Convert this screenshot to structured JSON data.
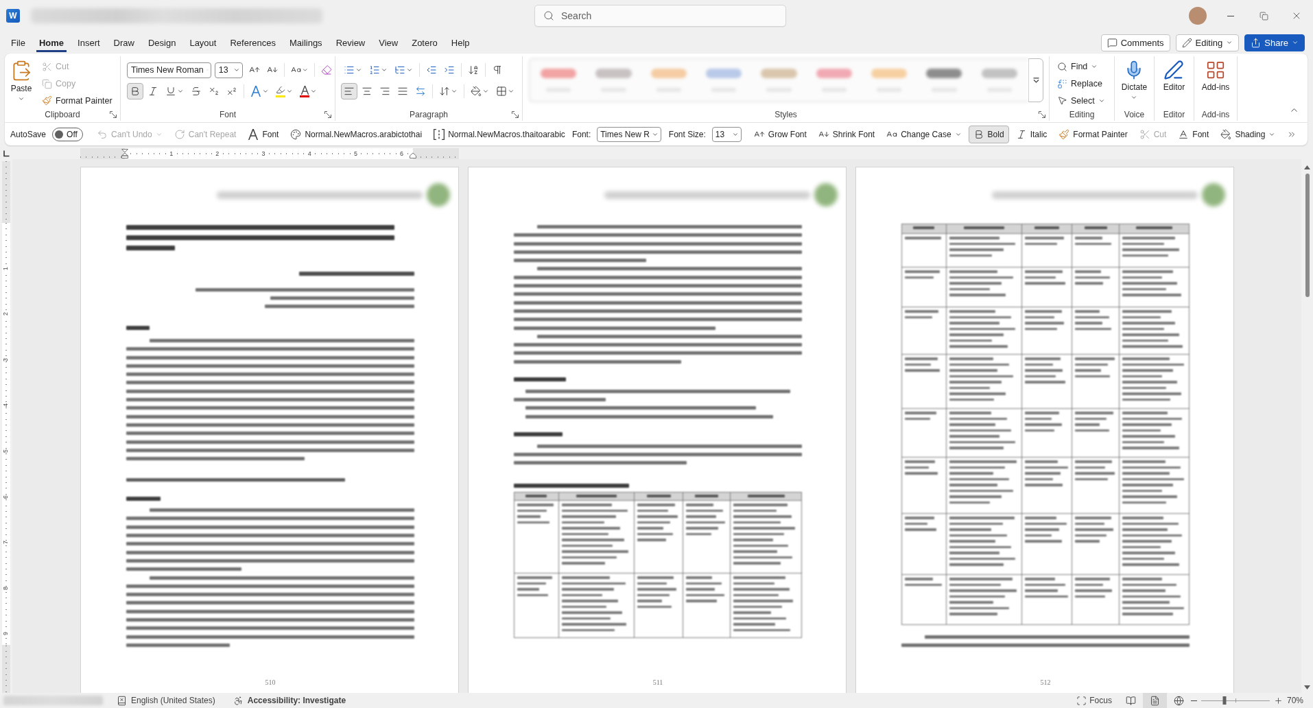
{
  "title_bar": {
    "app_letter": "W",
    "search": {
      "placeholder": "Search"
    }
  },
  "menu": {
    "tabs": [
      {
        "label": "File",
        "selected": false
      },
      {
        "label": "Home",
        "selected": true
      },
      {
        "label": "Insert",
        "selected": false
      },
      {
        "label": "Draw",
        "selected": false
      },
      {
        "label": "Design",
        "selected": false
      },
      {
        "label": "Layout",
        "selected": false
      },
      {
        "label": "References",
        "selected": false
      },
      {
        "label": "Mailings",
        "selected": false
      },
      {
        "label": "Review",
        "selected": false
      },
      {
        "label": "View",
        "selected": false
      },
      {
        "label": "Zotero",
        "selected": false
      },
      {
        "label": "Help",
        "selected": false
      }
    ],
    "buttons": [
      {
        "kind": "comments",
        "label": "Comments"
      },
      {
        "kind": "editing",
        "label": "Editing"
      },
      {
        "kind": "share",
        "label": "Share"
      }
    ]
  },
  "ribbon": {
    "clipboard": {
      "label": "Clipboard",
      "paste": "Paste",
      "items": [
        {
          "kind": "cut",
          "label": "Cut",
          "disabled": true
        },
        {
          "kind": "copy",
          "label": "Copy",
          "disabled": true
        },
        {
          "kind": "painter",
          "label": "Format Painter",
          "disabled": false
        }
      ]
    },
    "font": {
      "label": "Font",
      "font_name": "Times New Roman",
      "font_size": "13",
      "toggles": [
        {
          "kind": "bold",
          "on": true
        },
        {
          "kind": "italic",
          "on": false
        },
        {
          "kind": "underline",
          "on": false
        },
        {
          "kind": "strikethrough",
          "on": false
        },
        {
          "kind": "subscript",
          "on": false
        },
        {
          "kind": "superscript",
          "on": false
        }
      ]
    },
    "paragraph": {
      "label": "Paragraph",
      "alignments": [
        {
          "kind": "left",
          "selected": true
        },
        {
          "kind": "center",
          "selected": false
        },
        {
          "kind": "right",
          "selected": false
        },
        {
          "kind": "justify",
          "selected": false
        }
      ]
    },
    "styles": {
      "label": "Styles"
    },
    "editing": {
      "label": "Editing",
      "items": [
        {
          "kind": "find",
          "label": "Find",
          "dropdown": true
        },
        {
          "kind": "replace",
          "label": "Replace",
          "dropdown": false
        },
        {
          "kind": "select",
          "label": "Select",
          "dropdown": true
        }
      ]
    },
    "voice": {
      "label": "Voice",
      "button": "Dictate"
    },
    "editor": {
      "label": "Editor",
      "button": "Editor"
    },
    "add_ins": {
      "label": "Add-ins",
      "button": "Add-ins"
    }
  },
  "quick_access": {
    "autosave": {
      "label": "AutoSave",
      "on": false,
      "state": "Off"
    },
    "items": [
      {
        "kind": "undo",
        "label": "Can't Undo",
        "disabled": true,
        "pressed": false,
        "dropdown": true
      },
      {
        "kind": "repeat",
        "label": "Can't Repeat",
        "disabled": true,
        "pressed": false,
        "dropdown": false
      },
      {
        "kind": "fontdialog",
        "label": "Font",
        "disabled": false,
        "pressed": false,
        "dropdown": false
      },
      {
        "kind": "palette",
        "label": "Normal.NewMacros.arabictothai",
        "disabled": false,
        "pressed": false,
        "dropdown": false
      },
      {
        "kind": "brackets",
        "label": "Normal.NewMacros.thaitoarabic",
        "disabled": false,
        "pressed": false,
        "dropdown": false
      },
      {
        "kind": "fontname",
        "label": "Font:",
        "value": "Times New R"
      },
      {
        "kind": "fontsize",
        "label": "Font Size:",
        "value": "13"
      },
      {
        "kind": "grow",
        "label": "Grow Font",
        "disabled": false,
        "pressed": false,
        "dropdown": false
      },
      {
        "kind": "shrink",
        "label": "Shrink Font",
        "disabled": false,
        "pressed": false,
        "dropdown": false
      },
      {
        "kind": "case",
        "label": "Change Case",
        "disabled": false,
        "pressed": false,
        "dropdown": true
      },
      {
        "kind": "bold",
        "label": "Bold",
        "disabled": false,
        "pressed": true,
        "dropdown": false
      },
      {
        "kind": "italic",
        "label": "Italic",
        "disabled": false,
        "pressed": false,
        "dropdown": false
      },
      {
        "kind": "painter",
        "label": "Format Painter",
        "disabled": false,
        "pressed": false,
        "dropdown": false
      },
      {
        "kind": "cut",
        "label": "Cut",
        "disabled": true,
        "pressed": false,
        "dropdown": false
      },
      {
        "kind": "fontcolor",
        "label": "Font",
        "disabled": false,
        "pressed": false,
        "dropdown": false
      },
      {
        "kind": "shading",
        "label": "Shading",
        "disabled": false,
        "pressed": false,
        "dropdown": true
      }
    ]
  },
  "ruler": {
    "marks": [
      "1",
      "2",
      "3",
      "4",
      "5",
      "6"
    ]
  },
  "vertical_ruler": {
    "marks": [
      "1",
      "2",
      "3",
      "4",
      "5",
      "6",
      "7",
      "8",
      "9"
    ]
  },
  "pages": [
    {
      "page_number": "510"
    },
    {
      "page_number": "511"
    },
    {
      "page_number": "512"
    }
  ],
  "status_bar": {
    "language": "English (United States)",
    "accessibility": "Accessibility: Investigate",
    "focus": "Focus",
    "views": [
      {
        "kind": "read",
        "selected": false
      },
      {
        "kind": "print",
        "selected": true
      },
      {
        "kind": "web",
        "selected": false
      }
    ],
    "zoom": {
      "level": 0.34,
      "reading": "70%"
    }
  }
}
